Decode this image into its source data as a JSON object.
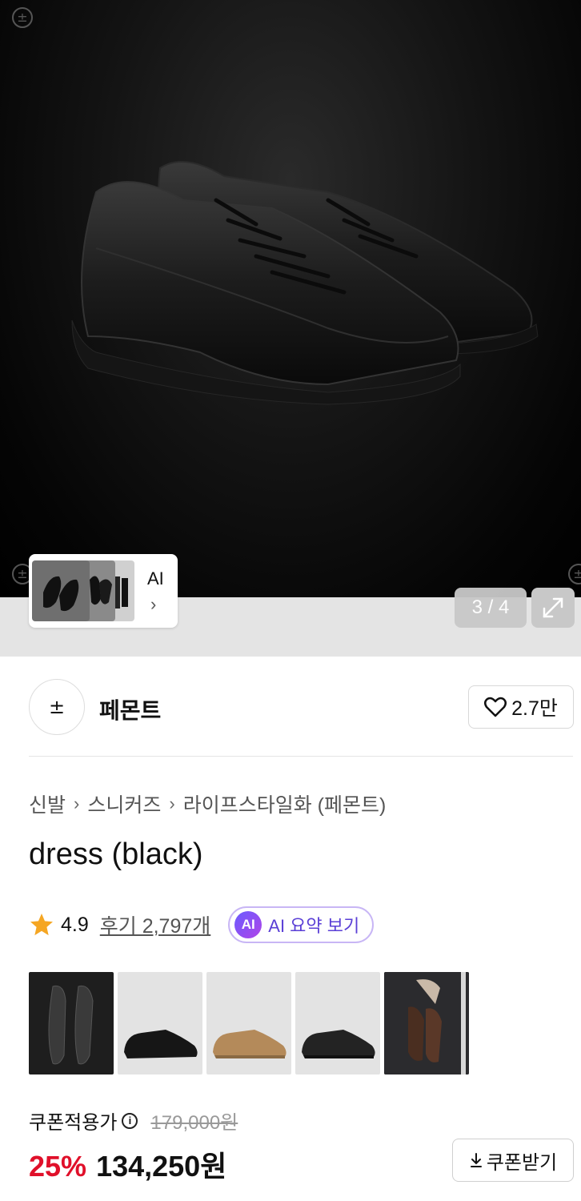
{
  "gallery": {
    "counter": "3 / 4",
    "watermark_symbol": "±",
    "ai_label": "AI",
    "ai_chevron": "›",
    "background": "#000000"
  },
  "brand": {
    "logo_symbol": "±",
    "name": "페몬트",
    "like_count": "2.7만"
  },
  "breadcrumb": {
    "items": [
      "신발",
      "스니커즈",
      "라이프스타일화 (페몬트)"
    ],
    "separator": "›"
  },
  "product": {
    "title": "dress (black)",
    "rating": "4.9",
    "reviews": "후기 2,797개",
    "ai_badge": "AI",
    "ai_summary": "AI 요약 보기"
  },
  "variants": [
    {
      "name": "black-top-view",
      "selected": true
    },
    {
      "name": "black-suede"
    },
    {
      "name": "tan-suede"
    },
    {
      "name": "black-leather"
    },
    {
      "name": "brown-suede-hanging"
    }
  ],
  "price": {
    "label": "쿠폰적용가",
    "info_icon": "info-icon",
    "original": "179,000원",
    "discount": "25%",
    "final": "134,250원",
    "coupon_button": "쿠폰받기",
    "discount_color": "#e0102a"
  },
  "colors": {
    "ai_accent": "#5a3fd6",
    "star": "#f5a623"
  }
}
